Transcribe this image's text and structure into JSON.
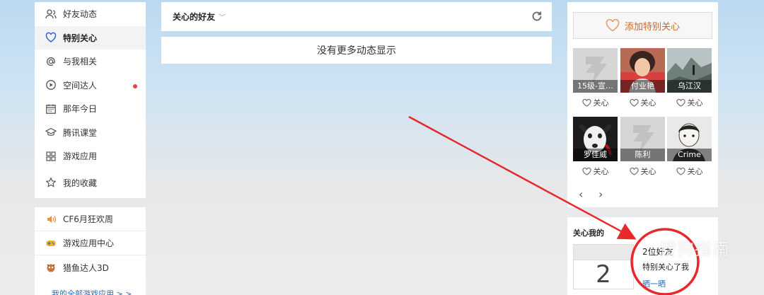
{
  "nav": {
    "items": [
      {
        "label": "好友动态",
        "icon": "friends-icon"
      },
      {
        "label": "特别关心",
        "icon": "heart-icon"
      },
      {
        "label": "与我相关",
        "icon": "at-icon"
      },
      {
        "label": "空间达人",
        "icon": "play-icon"
      },
      {
        "label": "那年今日",
        "icon": "calendar-icon"
      },
      {
        "label": "腾讯课堂",
        "icon": "graduation-icon"
      },
      {
        "label": "游戏应用",
        "icon": "apps-grid-icon"
      },
      {
        "label": "我的收藏",
        "icon": "star-icon"
      }
    ]
  },
  "apps": {
    "items": [
      {
        "label": "CF6月狂欢周"
      },
      {
        "label": "游戏应用中心"
      },
      {
        "label": "猎鱼达人3D"
      }
    ],
    "all_link": "我的全部游戏应用 > >"
  },
  "feed": {
    "title": "关心的好友",
    "empty_text": "没有更多动态显示"
  },
  "special": {
    "add_label": "添加特别关心",
    "care_label": "关心",
    "friends": [
      {
        "name": "15级-宣…"
      },
      {
        "name": "付业艳"
      },
      {
        "name": "乌江汉"
      },
      {
        "name": "罗佳威"
      },
      {
        "name": "陈利"
      },
      {
        "name": "Crime"
      }
    ]
  },
  "care_me": {
    "title": "关心我的",
    "count": "2",
    "line1": "2位好友",
    "line2": "特别关心了我",
    "link": "晒一晒"
  },
  "watermark": "搜狗指南",
  "colors": {
    "accent_orange": "#c86a25",
    "link_blue": "#2a6ab3",
    "annotation_red": "#e8292b"
  }
}
